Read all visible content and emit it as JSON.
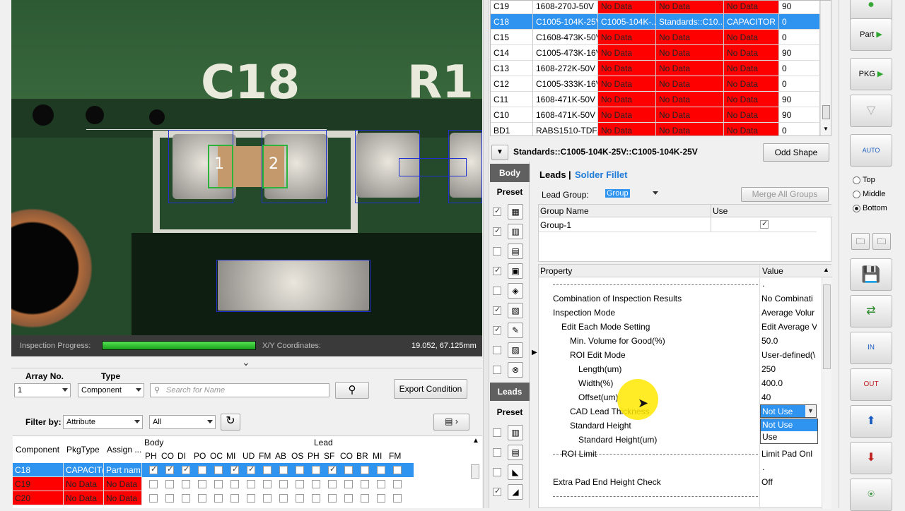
{
  "view": {
    "silk_top": "C18",
    "silk_right": "R1",
    "pad_labels": [
      "1",
      "2"
    ],
    "progress_label": "Inspection Progress:",
    "progress_fraction": 1.0,
    "coord_label": "X/Y Coordinates:",
    "coord_value": "19.052, 67.125mm"
  },
  "filters": {
    "array_label": "Array No.",
    "array_value": "1",
    "type_label": "Type",
    "type_value": "Component",
    "search_placeholder": "Search for Name",
    "export_label": "Export Condition",
    "filter_by_label": "Filter by:",
    "filter_value": "Attribute",
    "filter_all": "All"
  },
  "comp_grid": {
    "col_component": "Component",
    "col_pkgtype": "PkgType",
    "col_assign": "Assign ...",
    "group_body": "Body",
    "group_lead": "Lead",
    "body_cols": [
      "PH",
      "CO",
      "DI",
      "PO",
      "OC",
      "MI",
      "UD",
      "FM",
      "AB",
      "OS"
    ],
    "lead_cols": [
      "PH",
      "SF",
      "CO",
      "BR",
      "MI",
      "FM"
    ],
    "rows": [
      {
        "component": "C18",
        "pkgtype": "CAPACIT(",
        "assign": "Part nam",
        "checks": [
          1,
          1,
          1,
          0,
          0,
          1,
          1,
          0,
          0,
          0,
          0,
          1,
          0,
          0,
          0,
          0
        ]
      },
      {
        "component": "C19",
        "pkgtype": "No Data",
        "assign": "No Data",
        "checks": [
          0,
          0,
          0,
          0,
          0,
          0,
          0,
          0,
          0,
          0,
          0,
          0,
          0,
          0,
          0,
          0
        ]
      },
      {
        "component": "C20",
        "pkgtype": "No Data",
        "assign": "No Data",
        "checks": [
          0,
          0,
          0,
          0,
          0,
          0,
          0,
          0,
          0,
          0,
          0,
          0,
          0,
          0,
          0,
          0
        ]
      }
    ]
  },
  "parts_table": {
    "rows": [
      [
        "C19",
        "1608-270J-50V",
        "No Data",
        "No Data",
        "No Data",
        "90"
      ],
      [
        "C18",
        "C1005-104K-25V",
        "C1005-104K-...",
        "Standards::C10...",
        "CAPACITOR",
        "0"
      ],
      [
        "C15",
        "C1608-473K-50V",
        "No Data",
        "No Data",
        "No Data",
        "0"
      ],
      [
        "C14",
        "C1005-473K-16V",
        "No Data",
        "No Data",
        "No Data",
        "90"
      ],
      [
        "C13",
        "1608-272K-50V",
        "No Data",
        "No Data",
        "No Data",
        "0"
      ],
      [
        "C12",
        "C1005-333K-16V",
        "No Data",
        "No Data",
        "No Data",
        "0"
      ],
      [
        "C11",
        "1608-471K-50V",
        "No Data",
        "No Data",
        "No Data",
        "90"
      ],
      [
        "C10",
        "1608-471K-50V",
        "No Data",
        "No Data",
        "No Data",
        "90"
      ],
      [
        "BD1",
        "RABS1510-TDF...",
        "No Data",
        "No Data",
        "No Data",
        "0"
      ]
    ],
    "selected_index": 1
  },
  "editor": {
    "title": "Standards::C1005-104K-25V::C1005-104K-25V",
    "odd_shape": "Odd Shape",
    "body_btn": "Body",
    "preset_label": "Preset",
    "leads_btn": "Leads",
    "tab_leads": "Leads",
    "tab_sep": "|",
    "tab_solder": "Solder Fillet",
    "lead_group_label": "Lead Group:",
    "lead_group_value": "Group",
    "merge_label": "Merge All Groups",
    "group_col_name": "Group Name",
    "group_col_use": "Use",
    "group_row": "Group-1",
    "prop_col": "Property",
    "value_col": "Value"
  },
  "properties": [
    {
      "name": "Combination of Inspection Results",
      "value": "No Combinati"
    },
    {
      "name": "Inspection Mode",
      "value": "Average Volur"
    },
    {
      "name": "Edit Each Mode Setting",
      "value": "Edit Average V"
    },
    {
      "name": "Min. Volume for Good(%)",
      "value": "50.0"
    },
    {
      "name": "ROI Edit Mode",
      "value": "User-defined(\\"
    },
    {
      "name": "Length(um)",
      "value": "250"
    },
    {
      "name": "Width(%)",
      "value": "400.0"
    },
    {
      "name": "Offset(um)",
      "value": "40"
    },
    {
      "name": "CAD Lead Thickness",
      "value": "Not Use"
    },
    {
      "name": "Standard Height",
      "value": ""
    },
    {
      "name": "Standard Height(um)",
      "value": ""
    },
    {
      "name": "ROI Limit",
      "value": "Limit Pad Onl"
    },
    {
      "name": "Extra Pad End Height Check",
      "value": "Off"
    }
  ],
  "dropdown": {
    "options": [
      "Not Use",
      "Use"
    ]
  },
  "view_side": {
    "options": [
      "Top",
      "Middle",
      "Bottom"
    ],
    "selected": "Bottom"
  },
  "toolbar_icons": {
    "auto_label": "AUTO",
    "pkg_label": "PKG",
    "part_label": "Part",
    "in_label": "IN",
    "out_label": "OUT"
  }
}
